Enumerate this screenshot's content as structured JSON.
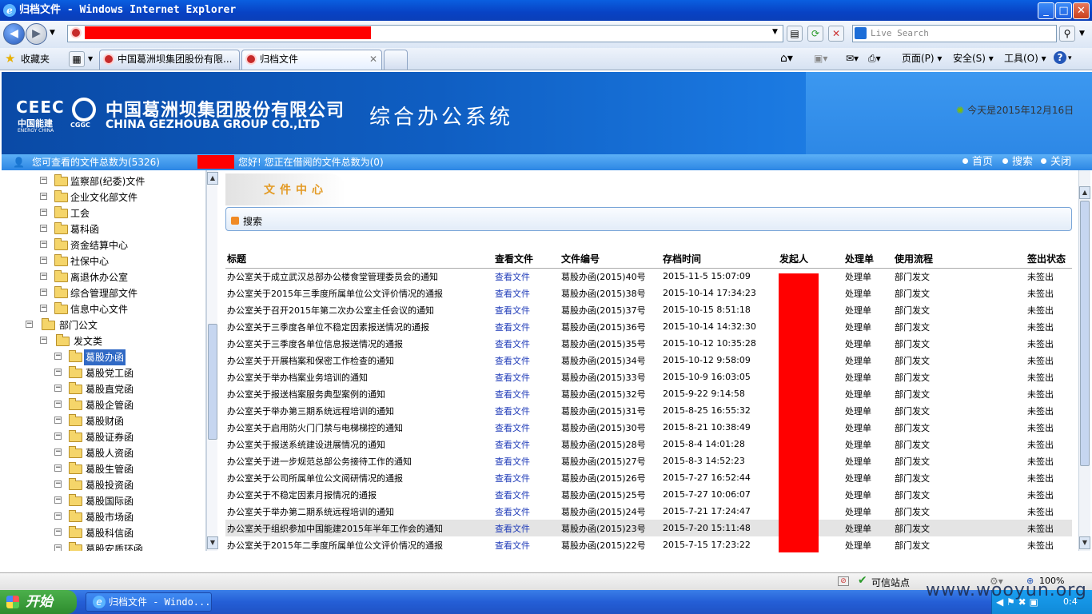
{
  "window": {
    "title": "归档文件 - Windows Internet Explorer",
    "btn_min": "_",
    "btn_max": "□",
    "btn_close": "✕"
  },
  "browser": {
    "search_placeholder": "Live Search",
    "favorites": "收藏夹",
    "tabs": [
      {
        "label": "中国葛洲坝集团股份有限..."
      },
      {
        "label": "归档文件"
      }
    ],
    "commands": {
      "page": "页面(P)",
      "safety": "安全(S)",
      "tools": "工具(O)",
      "help": "?"
    },
    "status": {
      "trusted": "可信站点",
      "zoom": "100%"
    }
  },
  "header": {
    "logo_left": "CEEC",
    "logo_left_cn": "中国能建",
    "logo_left_en": "ENERGY CHINA",
    "logo_right_sub": "CGGC",
    "company_cn": "中国葛洲坝集团股份有限公司",
    "company_en": "CHINA GEZHOUBA GROUP CO.,LTD",
    "system_title": "综合办公系统",
    "today": "今天是2015年12月16日"
  },
  "infobar": {
    "viewable": "您可查看的文件总数为(5326)",
    "greeting": "您好! 您正在借阅的文件总数为(0)",
    "links": [
      "首页",
      "搜索",
      "关闭"
    ]
  },
  "sidebar": {
    "items": [
      {
        "label": "监察部(纪委)文件"
      },
      {
        "label": "企业文化部文件"
      },
      {
        "label": "工会"
      },
      {
        "label": "葛科函"
      },
      {
        "label": "资金结算中心"
      },
      {
        "label": "社保中心"
      },
      {
        "label": "离退休办公室"
      },
      {
        "label": "综合管理部文件"
      },
      {
        "label": "信息中心文件"
      },
      {
        "label": "部门公文"
      },
      {
        "label": "发文类"
      },
      {
        "label": "葛股办函"
      },
      {
        "label": "葛股党工函"
      },
      {
        "label": "葛股直党函"
      },
      {
        "label": "葛股企管函"
      },
      {
        "label": "葛股财函"
      },
      {
        "label": "葛股证券函"
      },
      {
        "label": "葛股人资函"
      },
      {
        "label": "葛股生管函"
      },
      {
        "label": "葛股投资函"
      },
      {
        "label": "葛股国际函"
      },
      {
        "label": "葛股市场函"
      },
      {
        "label": "葛股科信函"
      },
      {
        "label": "葛股安质环函"
      }
    ]
  },
  "main": {
    "section_title": "文件中心",
    "search_label": "搜索",
    "columns": [
      "标题",
      "查看文件",
      "文件编号",
      "存档时间",
      "发起人",
      "处理单",
      "使用流程",
      "签出状态"
    ],
    "rows": [
      {
        "title": "办公室关于成立武汉总部办公楼食堂管理委员会的通知",
        "view": "查看文件",
        "number": "葛股办函(2015)40号",
        "time": "2015-11-5 15:07:09",
        "form": "处理单",
        "flow": "部门发文",
        "status": "未签出"
      },
      {
        "title": "办公室关于2015年三季度所属单位公文评价情况的通报",
        "view": "查看文件",
        "number": "葛股办函(2015)38号",
        "time": "2015-10-14 17:34:23",
        "form": "处理单",
        "flow": "部门发文",
        "status": "未签出"
      },
      {
        "title": "办公室关于召开2015年第二次办公室主任会议的通知",
        "view": "查看文件",
        "number": "葛股办函(2015)37号",
        "time": "2015-10-15 8:51:18",
        "form": "处理单",
        "flow": "部门发文",
        "status": "未签出"
      },
      {
        "title": "办公室关于三季度各单位不稳定因素报送情况的通报",
        "view": "查看文件",
        "number": "葛股办函(2015)36号",
        "time": "2015-10-14 14:32:30",
        "form": "处理单",
        "flow": "部门发文",
        "status": "未签出"
      },
      {
        "title": "办公室关于三季度各单位信息报送情况的通报",
        "view": "查看文件",
        "number": "葛股办函(2015)35号",
        "time": "2015-10-12 10:35:28",
        "form": "处理单",
        "flow": "部门发文",
        "status": "未签出"
      },
      {
        "title": "办公室关于开展档案和保密工作检查的通知",
        "view": "查看文件",
        "number": "葛股办函(2015)34号",
        "time": "2015-10-12 9:58:09",
        "form": "处理单",
        "flow": "部门发文",
        "status": "未签出"
      },
      {
        "title": "办公室关于举办档案业务培训的通知",
        "view": "查看文件",
        "number": "葛股办函(2015)33号",
        "time": "2015-10-9 16:03:05",
        "form": "处理单",
        "flow": "部门发文",
        "status": "未签出"
      },
      {
        "title": "办公室关于报送档案服务典型案例的通知",
        "view": "查看文件",
        "number": "葛股办函(2015)32号",
        "time": "2015-9-22 9:14:58",
        "form": "处理单",
        "flow": "部门发文",
        "status": "未签出"
      },
      {
        "title": "办公室关于举办第三期系统远程培训的通知",
        "view": "查看文件",
        "number": "葛股办函(2015)31号",
        "time": "2015-8-25 16:55:32",
        "form": "处理单",
        "flow": "部门发文",
        "status": "未签出"
      },
      {
        "title": "办公室关于启用防火门门禁与电梯梯控的通知",
        "view": "查看文件",
        "number": "葛股办函(2015)30号",
        "time": "2015-8-21 10:38:49",
        "form": "处理单",
        "flow": "部门发文",
        "status": "未签出"
      },
      {
        "title": "办公室关于报送系统建设进展情况的通知",
        "view": "查看文件",
        "number": "葛股办函(2015)28号",
        "time": "2015-8-4 14:01:28",
        "form": "处理单",
        "flow": "部门发文",
        "status": "未签出"
      },
      {
        "title": "办公室关于进一步规范总部公务接待工作的通知",
        "view": "查看文件",
        "number": "葛股办函(2015)27号",
        "time": "2015-8-3 14:52:23",
        "form": "处理单",
        "flow": "部门发文",
        "status": "未签出"
      },
      {
        "title": "办公室关于公司所属单位公文阅研情况的通报",
        "view": "查看文件",
        "number": "葛股办函(2015)26号",
        "time": "2015-7-27 16:52:44",
        "form": "处理单",
        "flow": "部门发文",
        "status": "未签出"
      },
      {
        "title": "办公室关于不稳定因素月报情况的通报",
        "view": "查看文件",
        "number": "葛股办函(2015)25号",
        "time": "2015-7-27 10:06:07",
        "form": "处理单",
        "flow": "部门发文",
        "status": "未签出"
      },
      {
        "title": "办公室关于举办第二期系统远程培训的通知",
        "view": "查看文件",
        "number": "葛股办函(2015)24号",
        "time": "2015-7-21 17:24:47",
        "form": "处理单",
        "flow": "部门发文",
        "status": "未签出"
      },
      {
        "title": "办公室关于组织参加中国能建2015年半年工作会的通知",
        "view": "查看文件",
        "number": "葛股办函(2015)23号",
        "time": "2015-7-20 15:11:48",
        "form": "处理单",
        "flow": "部门发文",
        "status": "未签出"
      },
      {
        "title": "办公室关于2015年二季度所属单位公文评价情况的通报",
        "view": "查看文件",
        "number": "葛股办函(2015)22号",
        "time": "2015-7-15 17:23:22",
        "form": "处理单",
        "flow": "部门发文",
        "status": "未签出"
      }
    ]
  },
  "taskbar": {
    "start": "开始",
    "task_ie": "归档文件 - Windo...",
    "clock": "0:4",
    "watermark": "www.wooyun.org"
  },
  "colors": {
    "redaction": "#ff0000",
    "banner_blue": "#0f5ec2",
    "link_blue": "#1f3bb8",
    "accent_orange": "#e39a24"
  }
}
